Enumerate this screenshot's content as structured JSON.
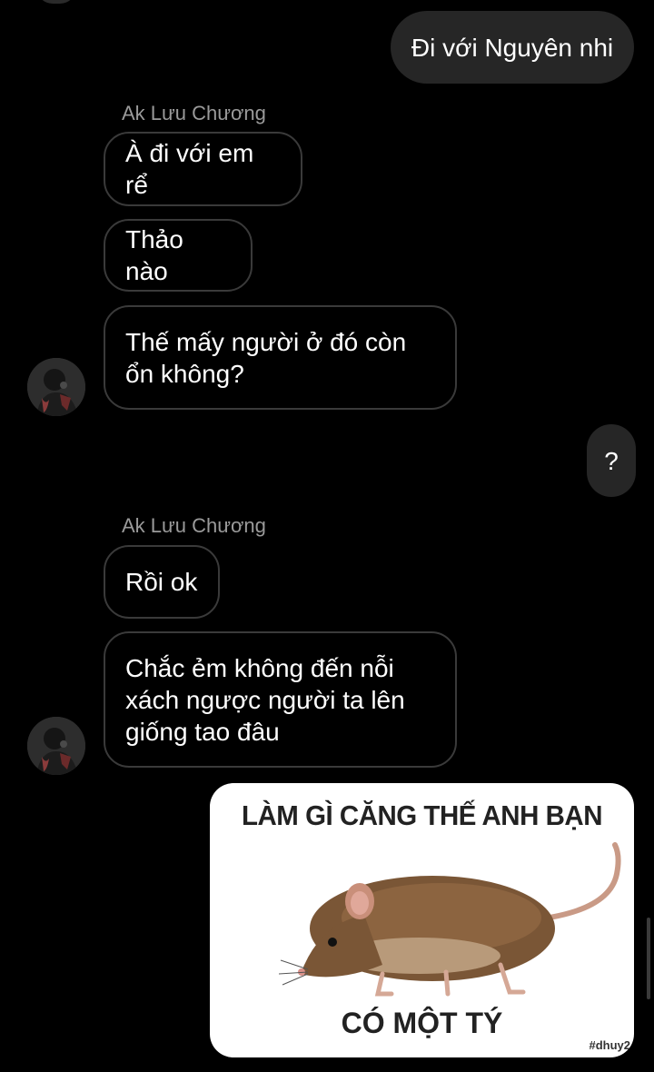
{
  "conversation": {
    "messages": [
      {
        "from": "me",
        "text": "Đi với Nguyên nhi"
      },
      {
        "from": "them",
        "text": "À đi với em rể"
      },
      {
        "from": "them",
        "text": "Thảo nào"
      },
      {
        "from": "them",
        "text": "Thế mấy người ở đó còn ổn không?"
      },
      {
        "from": "me",
        "text": "?"
      },
      {
        "from": "them",
        "text": "Rồi ok"
      },
      {
        "from": "them",
        "text": "Chắc ẻm không đến nỗi xách ngược người ta lên giống tao đâu"
      }
    ],
    "sender_labels": [
      "Ak Lưu Chương",
      "Ak Lưu Chương"
    ],
    "sticker": {
      "top_text": "LÀM GÌ CĂNG THẾ ANH BẠN",
      "bottom_text": "CÓ MỘT TÝ",
      "watermark": "#dhuy2"
    }
  },
  "colors": {
    "background": "#000000",
    "incoming_border": "#3a3a3a",
    "outgoing_bubble": "#262626",
    "sender_label": "#9a9a9a"
  }
}
